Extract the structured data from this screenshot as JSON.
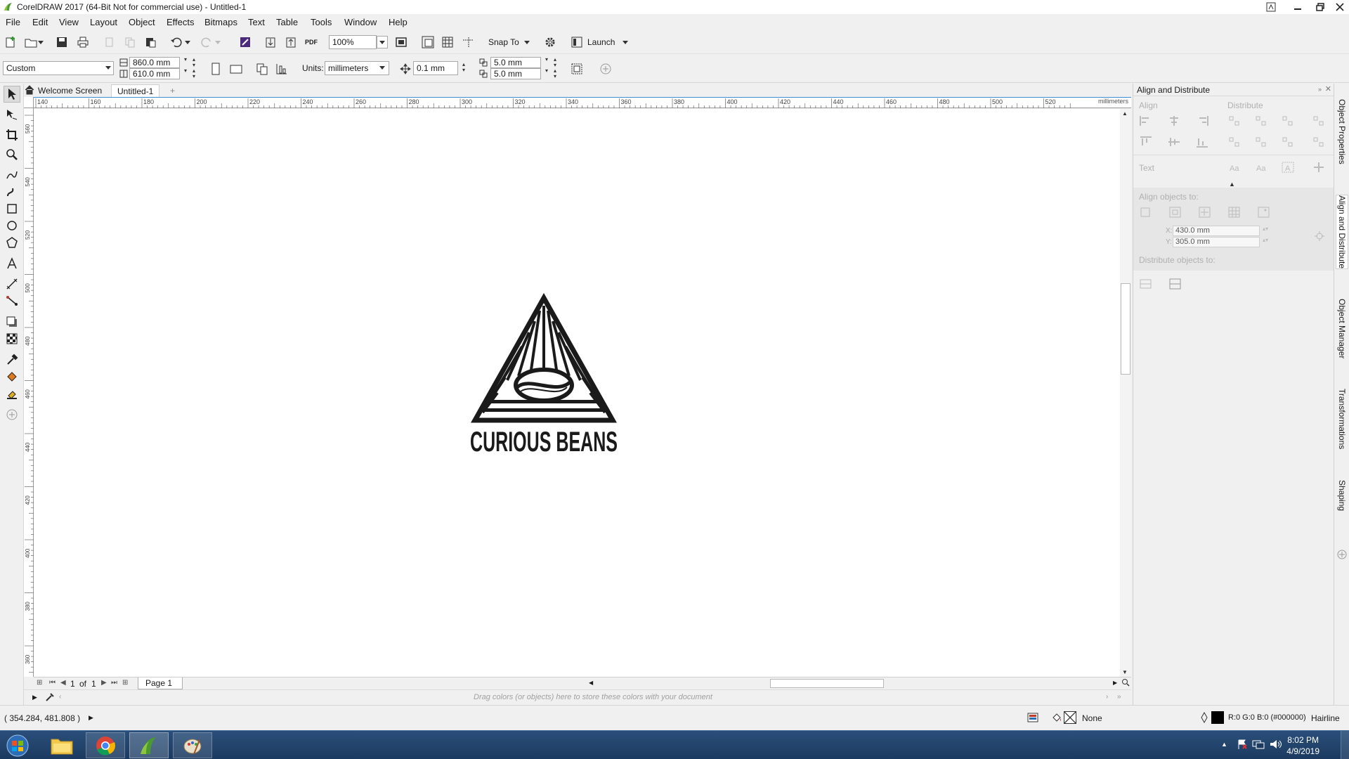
{
  "titlebar": {
    "title": "CorelDRAW 2017 (64-Bit Not for commercial use) - Untitled-1"
  },
  "menu": [
    {
      "u": "F",
      "rest": "ile"
    },
    {
      "u": "E",
      "rest": "dit"
    },
    {
      "u": "V",
      "rest": "iew"
    },
    {
      "u": "L",
      "rest": "ayout"
    },
    {
      "u": "O",
      "rest": "bject"
    },
    {
      "u": "E",
      "rest": "ffects",
      "pre": ""
    },
    {
      "u": "B",
      "rest": "itmaps"
    },
    {
      "u": "T",
      "rest": "ext"
    },
    {
      "u": "T",
      "rest": "able"
    },
    {
      "u": "T",
      "rest": "ools",
      "pre": ""
    },
    {
      "u": "W",
      "rest": "indow"
    },
    {
      "u": "H",
      "rest": "elp"
    }
  ],
  "menu_labels": [
    "File",
    "Edit",
    "View",
    "Layout",
    "Object",
    "Effects",
    "Bitmaps",
    "Text",
    "Table",
    "Tools",
    "Window",
    "Help"
  ],
  "standard_toolbar": {
    "zoom": "100%",
    "snap_to": "Snap To",
    "launch": "Launch",
    "pdf_label": "PDF"
  },
  "property_bar": {
    "page_preset": "Custom",
    "width": "860.0 mm",
    "height": "610.0 mm",
    "units_label": "Units:",
    "units": "millimeters",
    "nudge": "0.1 mm",
    "dup_x": "5.0 mm",
    "dup_y": "5.0 mm"
  },
  "tabs": {
    "welcome": "Welcome Screen",
    "document": "Untitled-1"
  },
  "ruler": {
    "h_ticks": [
      "140",
      "160",
      "180",
      "200",
      "220",
      "240",
      "260",
      "280",
      "300",
      "320",
      "340",
      "360",
      "380",
      "400",
      "420",
      "440",
      "460",
      "480",
      "500",
      "520"
    ],
    "units": "millimeters",
    "v_ticks": [
      "560",
      "540",
      "520",
      "500",
      "480",
      "460",
      "440",
      "420",
      "400",
      "380",
      "360"
    ]
  },
  "artwork": {
    "brand_text": "CURIOUS BEANS"
  },
  "page_nav": {
    "current": "1",
    "of": "of",
    "total": "1",
    "page_tab": "Page 1"
  },
  "palette_hint": "Drag colors (or objects) here to store these colors with your document",
  "status": {
    "coords": "( 354.284, 481.808 )",
    "fill": "None",
    "outline_color": "R:0 G:0 B:0 (#000000)",
    "outline_width": "Hairline"
  },
  "docker": {
    "title": "Align and Distribute",
    "align": "Align",
    "distribute": "Distribute",
    "text": "Text",
    "align_to": "Align objects to:",
    "x_label": "X:",
    "x_value": "430.0 mm",
    "y_label": "Y:",
    "y_value": "305.0 mm",
    "distribute_to": "Distribute objects to:"
  },
  "docker_tabs": [
    "Object Properties",
    "Align and Distribute",
    "Object Manager",
    "Transformations",
    "Shaping"
  ],
  "taskbar": {
    "time": "8:02 PM",
    "date": "4/9/2019"
  },
  "colors": {
    "accent": "#3d8ed9",
    "taskbar": "#1c3a60",
    "artwork": "#1a1a1a"
  }
}
